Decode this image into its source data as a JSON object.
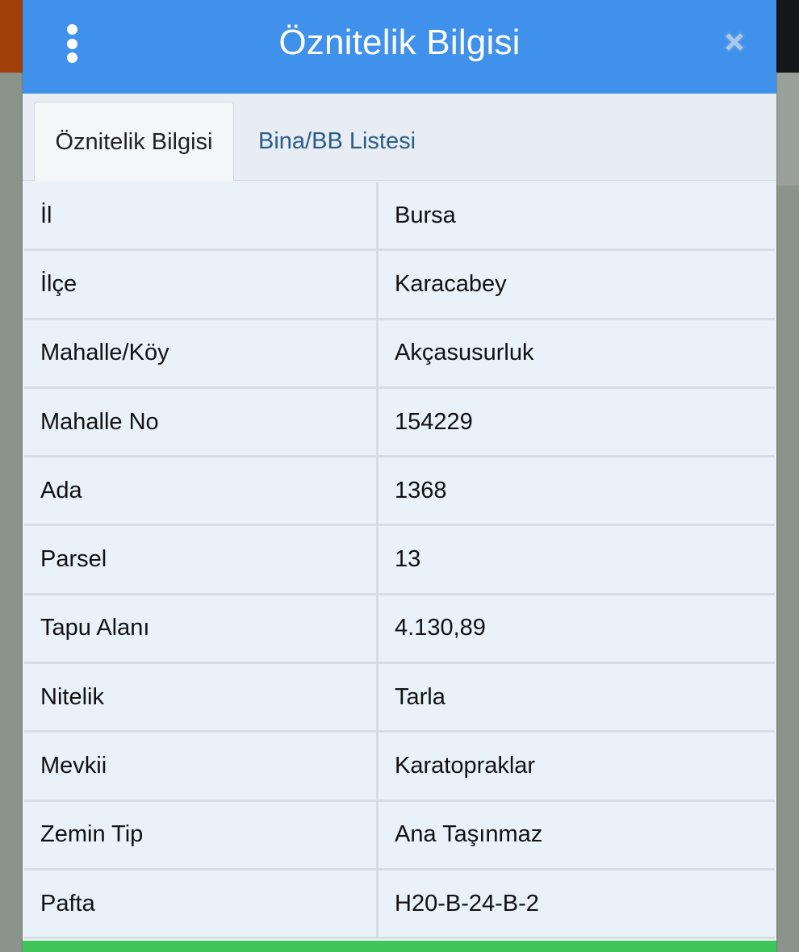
{
  "window": {
    "title": "Öznitelik Bilgisi"
  },
  "icons": {
    "menu": "vertical-dots-icon",
    "close": "close-x-icon"
  },
  "colors": {
    "header": "#3f91ec",
    "footer_bar": "#3ec65a",
    "cell_bg": "#e9f2f9"
  },
  "tabs": [
    {
      "label": "Öznitelik Bilgisi",
      "active": true
    },
    {
      "label": "Bina/BB Listesi",
      "active": false
    }
  ],
  "attributes": [
    {
      "key": "İl",
      "value": "Bursa"
    },
    {
      "key": "İlçe",
      "value": "Karacabey"
    },
    {
      "key": "Mahalle/Köy",
      "value": "Akçasusurluk"
    },
    {
      "key": "Mahalle No",
      "value": "154229"
    },
    {
      "key": "Ada",
      "value": "1368"
    },
    {
      "key": "Parsel",
      "value": "13"
    },
    {
      "key": "Tapu Alanı",
      "value": "4.130,89"
    },
    {
      "key": "Nitelik",
      "value": "Tarla"
    },
    {
      "key": "Mevkii",
      "value": "Karatopraklar"
    },
    {
      "key": "Zemin Tip",
      "value": "Ana Taşınmaz"
    },
    {
      "key": "Pafta",
      "value": "H20-B-24-B-2"
    }
  ]
}
